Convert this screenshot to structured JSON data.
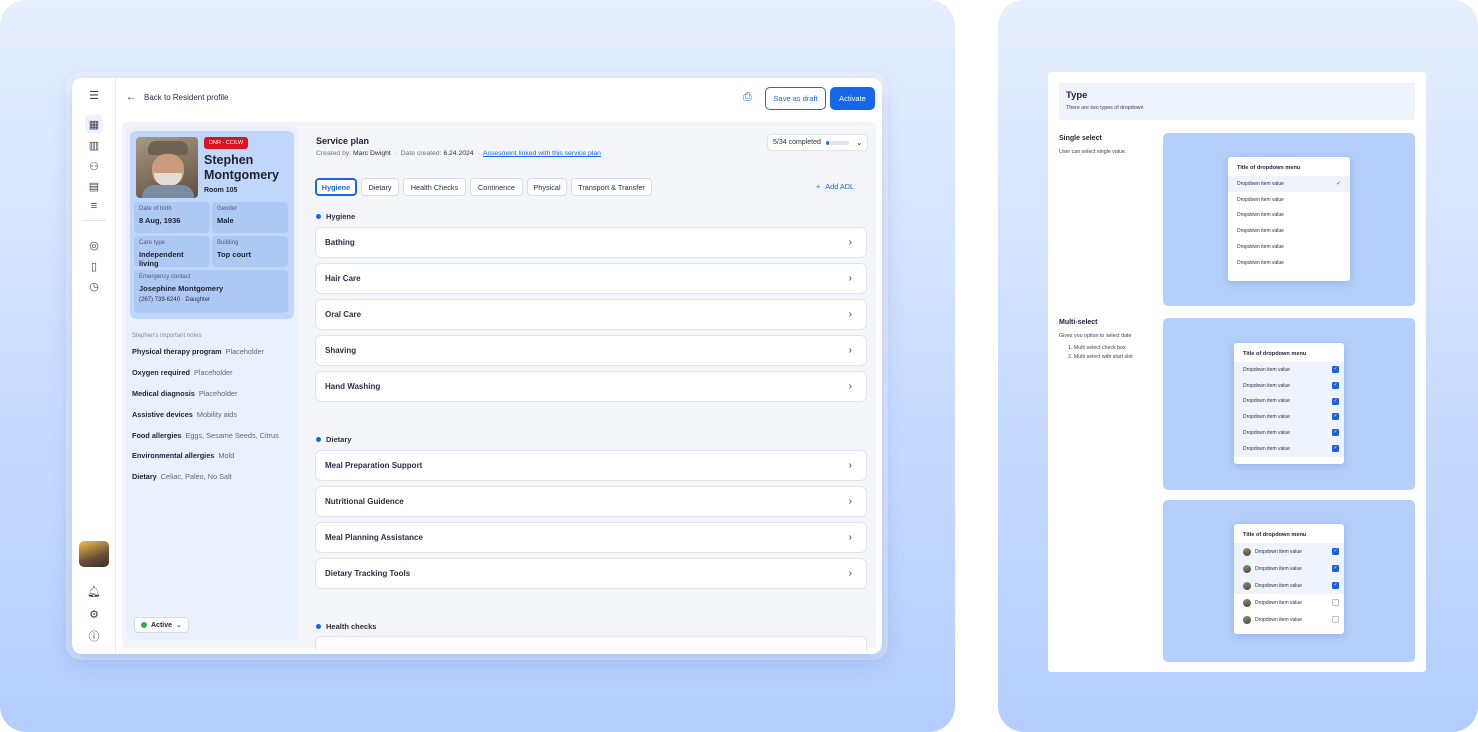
{
  "app": {
    "back_label": "Back to Resident profile",
    "save_draft_label": "Save as draft",
    "activate_label": "Activate",
    "status_label": "Active"
  },
  "resident": {
    "badge": "DNR - CC/LW",
    "first_name": "Stephen",
    "last_name": "Montgomery",
    "room": "Room 105",
    "dob_label": "Date of birth",
    "dob": "8 Aug, 1936",
    "gender_label": "Gender",
    "gender": "Male",
    "care_type_label": "Care type",
    "care_type": "Independent living",
    "building_label": "Building",
    "building": "Top court",
    "emergency_label": "Emergency contact",
    "emergency_name": "Josephine Montgomery",
    "emergency_phone": "(267) 739-6240",
    "emergency_relation": "Daughter",
    "notes_title": "Stephen's important notes",
    "notes": [
      {
        "label": "Physical therapy program",
        "value": "Placeholder"
      },
      {
        "label": "Oxygen required",
        "value": "Placeholder"
      },
      {
        "label": "Medical diagnosis",
        "value": "Placeholder"
      },
      {
        "label": "Assistive devices",
        "value": "Mobility aids"
      },
      {
        "label": "Food allergies",
        "value": "Eggs, Sesame Seeds, Citrus"
      },
      {
        "label": "Environmental allergies",
        "value": "Mold"
      },
      {
        "label": "Dietary",
        "value": "Celiac, Paleo, No Salt"
      }
    ]
  },
  "plan": {
    "title": "Service plan",
    "created_by_label": "Created by:",
    "created_by": "Marc Dwight",
    "date_label": "Date created:",
    "date": "6.24.2024",
    "link": "Assesment linked with this service plan",
    "progress_label": "5/34 completed",
    "progress_fraction": 0.15,
    "add_adl": "Add ADL",
    "tabs": [
      "Hygiene",
      "Dietary",
      "Health Checks",
      "Continence",
      "Physical",
      "Transport & Transfer"
    ],
    "sections": [
      {
        "title": "Hygiene",
        "items": [
          "Bathing",
          "Hair Care",
          "Oral Care",
          "Shaving",
          "Hand Washing"
        ]
      },
      {
        "title": "Dietary",
        "items": [
          "Meal Preparation Support",
          "Nutritional Guidence",
          "Meal Planning Assistance",
          "Dietary Tracking Tools"
        ]
      },
      {
        "title": "Health checks",
        "items": []
      }
    ]
  },
  "doc": {
    "title": "Type",
    "subtitle": "There are two types of dropdown",
    "single_title": "Single select",
    "single_desc": "User can select single value.",
    "multi_title": "Multi-select",
    "multi_desc": "Gives you option to select date",
    "multi_list": [
      "1. Multi select check box",
      "2. Multi select with start slot"
    ],
    "dropdown_title": "Title of dropdown menu",
    "item": "Dropdown item value",
    "check": "✓"
  },
  "colors": {
    "accent": "#1768e8",
    "badge": "#d7141f",
    "status_green": "#2bb24c"
  }
}
